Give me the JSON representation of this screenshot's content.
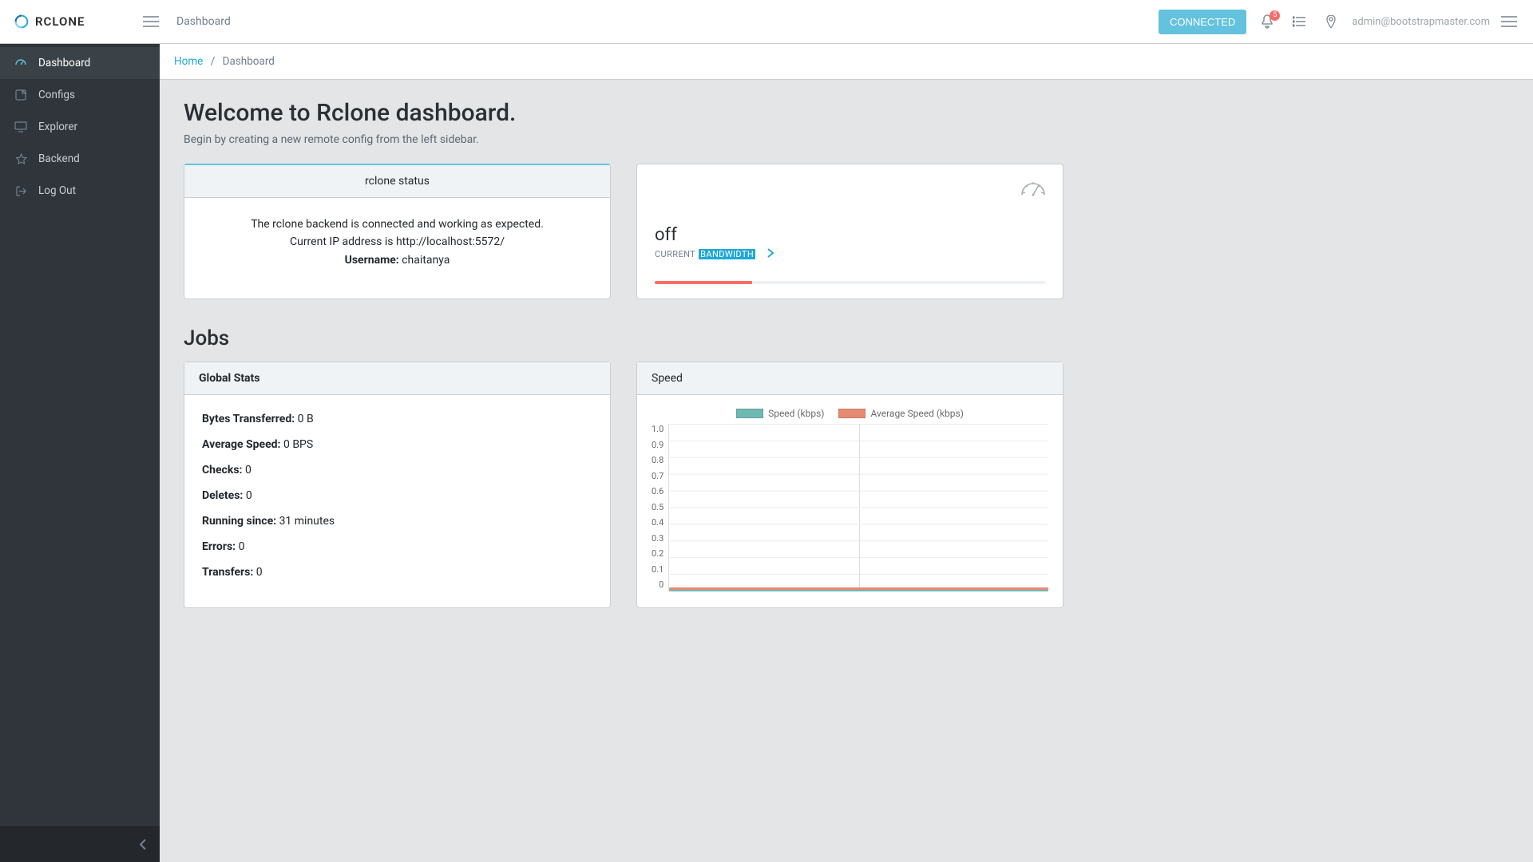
{
  "brand": {
    "name": "RCLONE"
  },
  "header": {
    "title": "Dashboard",
    "connect_label": "CONNECTED",
    "notification_count": "5",
    "user_email": "admin@bootstrapmaster.com"
  },
  "sidebar": {
    "items": [
      {
        "label": "Dashboard",
        "icon": "speedometer-icon",
        "active": true
      },
      {
        "label": "Configs",
        "icon": "note-icon"
      },
      {
        "label": "Explorer",
        "icon": "screen-icon"
      },
      {
        "label": "Backend",
        "icon": "star-icon"
      },
      {
        "label": "Log Out",
        "icon": "logout-icon"
      }
    ]
  },
  "breadcrumb": {
    "home": "Home",
    "current": "Dashboard"
  },
  "welcome": {
    "title": "Welcome to Rclone dashboard.",
    "subtitle": "Begin by creating a new remote config from the left sidebar."
  },
  "status_card": {
    "header": "rclone status",
    "line1": "The rclone backend is connected and working as expected.",
    "line2_prefix": "Current IP address is ",
    "ip": "http://localhost:5572/",
    "username_label": "Username:",
    "username": "chaitanya"
  },
  "bandwidth_card": {
    "value": "off",
    "label_prefix": "CURRENT",
    "label_highlight": "BANDWIDTH",
    "progress_pct": 25
  },
  "jobs_title": "Jobs",
  "global_stats": {
    "header": "Global Stats",
    "rows": [
      {
        "label": "Bytes Transferred:",
        "value": "0 B"
      },
      {
        "label": "Average Speed:",
        "value": "0 BPS"
      },
      {
        "label": "Checks:",
        "value": "0"
      },
      {
        "label": "Deletes:",
        "value": "0"
      },
      {
        "label": "Running since:",
        "value": "31 minutes"
      },
      {
        "label": "Errors:",
        "value": "0"
      },
      {
        "label": "Transfers:",
        "value": "0"
      }
    ]
  },
  "speed_card": {
    "header": "Speed",
    "legend": [
      {
        "name": "Speed (kbps)",
        "color": "#6fb9b3"
      },
      {
        "name": "Average Speed (kbps)",
        "color": "#e58b74"
      }
    ]
  },
  "colors": {
    "accent": "#63c2de",
    "link": "#20a8d8",
    "danger": "#f86c6b",
    "sidebar_bg": "#2f353a"
  },
  "chart_data": {
    "type": "line",
    "ylabel": "kbps",
    "ylim": [
      0,
      1.0
    ],
    "y_ticks": [
      "1.0",
      "0.9",
      "0.8",
      "0.7",
      "0.6",
      "0.5",
      "0.4",
      "0.3",
      "0.2",
      "0.1",
      "0"
    ],
    "series": [
      {
        "name": "Speed (kbps)",
        "color": "#6fb9b3",
        "values": [
          0,
          0,
          0,
          0,
          0,
          0,
          0,
          0,
          0,
          0
        ]
      },
      {
        "name": "Average Speed (kbps)",
        "color": "#e58b74",
        "values": [
          0,
          0,
          0,
          0,
          0,
          0,
          0,
          0,
          0,
          0
        ]
      }
    ]
  }
}
